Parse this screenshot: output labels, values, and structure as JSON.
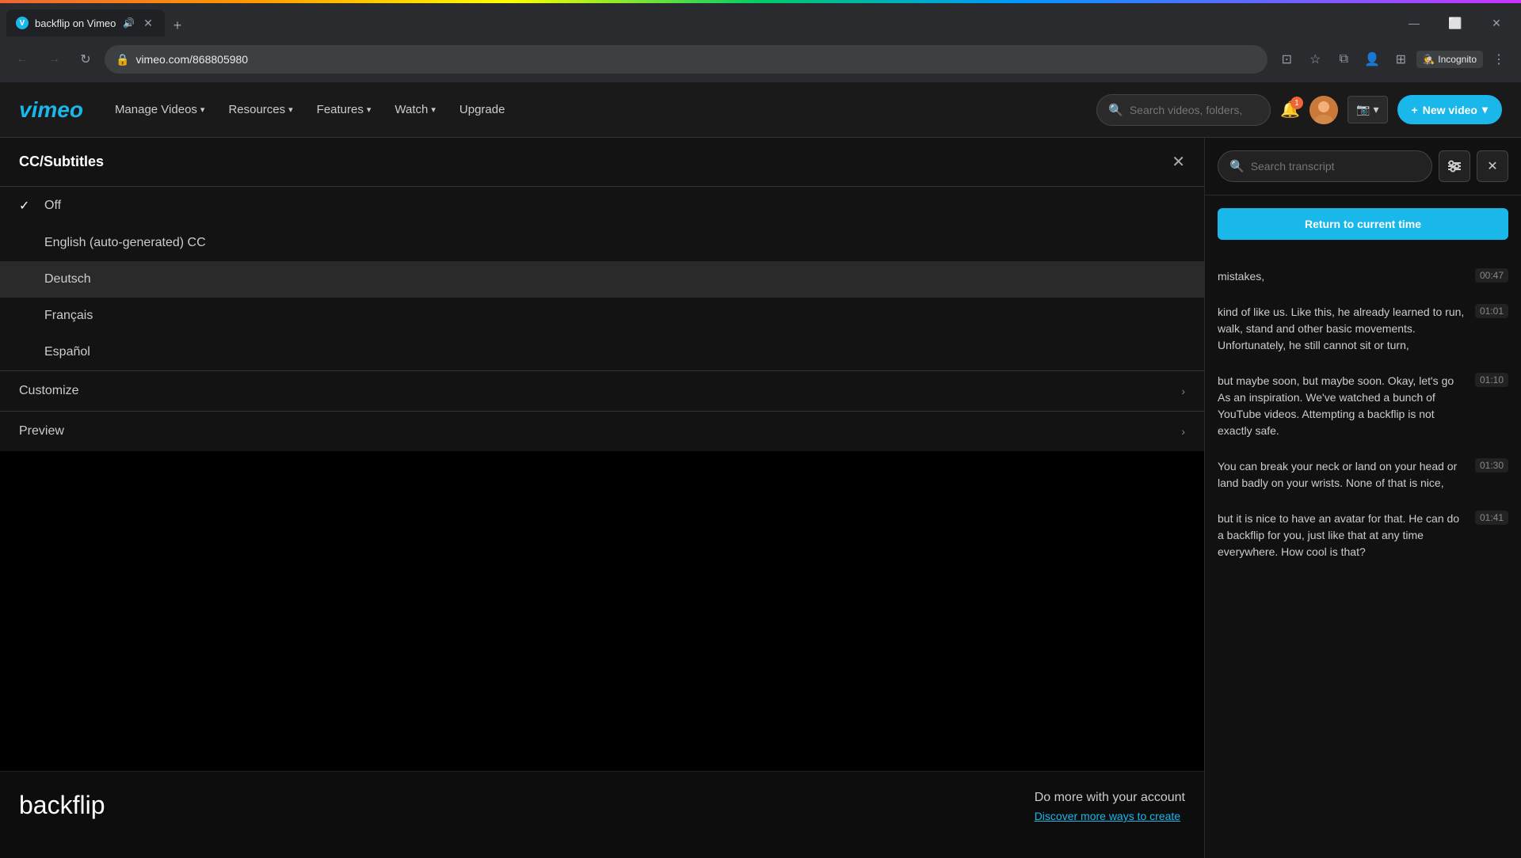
{
  "browser": {
    "tab": {
      "title": "backflip on Vimeo",
      "favicon_letter": "V",
      "sound_icon": "🔊"
    },
    "url": "vimeo.com/868805980",
    "incognito_label": "Incognito"
  },
  "header": {
    "logo": "vimeo",
    "nav": [
      {
        "id": "manage-videos",
        "label": "Manage Videos",
        "has_dropdown": true
      },
      {
        "id": "resources",
        "label": "Resources",
        "has_dropdown": true
      },
      {
        "id": "features",
        "label": "Features",
        "has_dropdown": true
      },
      {
        "id": "watch",
        "label": "Watch",
        "has_dropdown": true
      },
      {
        "id": "upgrade",
        "label": "Upgrade",
        "has_dropdown": false
      }
    ],
    "search_placeholder": "Search videos, folders,",
    "notification_count": "1",
    "new_video_label": "New video",
    "camera_selector_icon": "📷"
  },
  "cc_panel": {
    "title": "CC/Subtitles",
    "items": [
      {
        "id": "off",
        "label": "Off",
        "checked": true
      },
      {
        "id": "english-cc",
        "label": "English (auto-generated) CC",
        "checked": false
      },
      {
        "id": "deutsch",
        "label": "Deutsch",
        "checked": false,
        "highlighted": true
      },
      {
        "id": "francais",
        "label": "Français",
        "checked": false
      },
      {
        "id": "espanol",
        "label": "Español",
        "checked": false
      }
    ],
    "actions": [
      {
        "id": "customize",
        "label": "Customize"
      },
      {
        "id": "preview",
        "label": "Preview"
      }
    ]
  },
  "transcript": {
    "search_placeholder": "Search transcript",
    "return_button_label": "Return to current time",
    "entries": [
      {
        "id": "entry-1",
        "text": "mistakes,",
        "time": "00:47"
      },
      {
        "id": "entry-2",
        "text": "kind of like us. Like this, he already learned to run, walk, stand and other basic movements. Unfortunately, he still cannot sit or turn,",
        "time": "01:01"
      },
      {
        "id": "entry-3",
        "text": "but maybe soon, but maybe soon. Okay, let's go As an inspiration. We've watched a bunch of YouTube videos. Attempting a backflip is not exactly safe.",
        "time": "01:10"
      },
      {
        "id": "entry-4",
        "text": "You can break your neck or land on your head or land badly on your wrists. None of that is nice,",
        "time": "01:30"
      },
      {
        "id": "entry-5",
        "text": "but it is nice to have an avatar for that. He can do a backflip for you, just like that at any time everywhere. How cool is that?",
        "time": "01:41"
      }
    ]
  },
  "bottom": {
    "video_title": "backflip",
    "do_more_title": "Do more with your account",
    "do_more_link": "Discover more ways to create"
  },
  "colors": {
    "accent": "#1ab7ea",
    "bg_dark": "#111111",
    "bg_panel": "#1a1a1a"
  }
}
